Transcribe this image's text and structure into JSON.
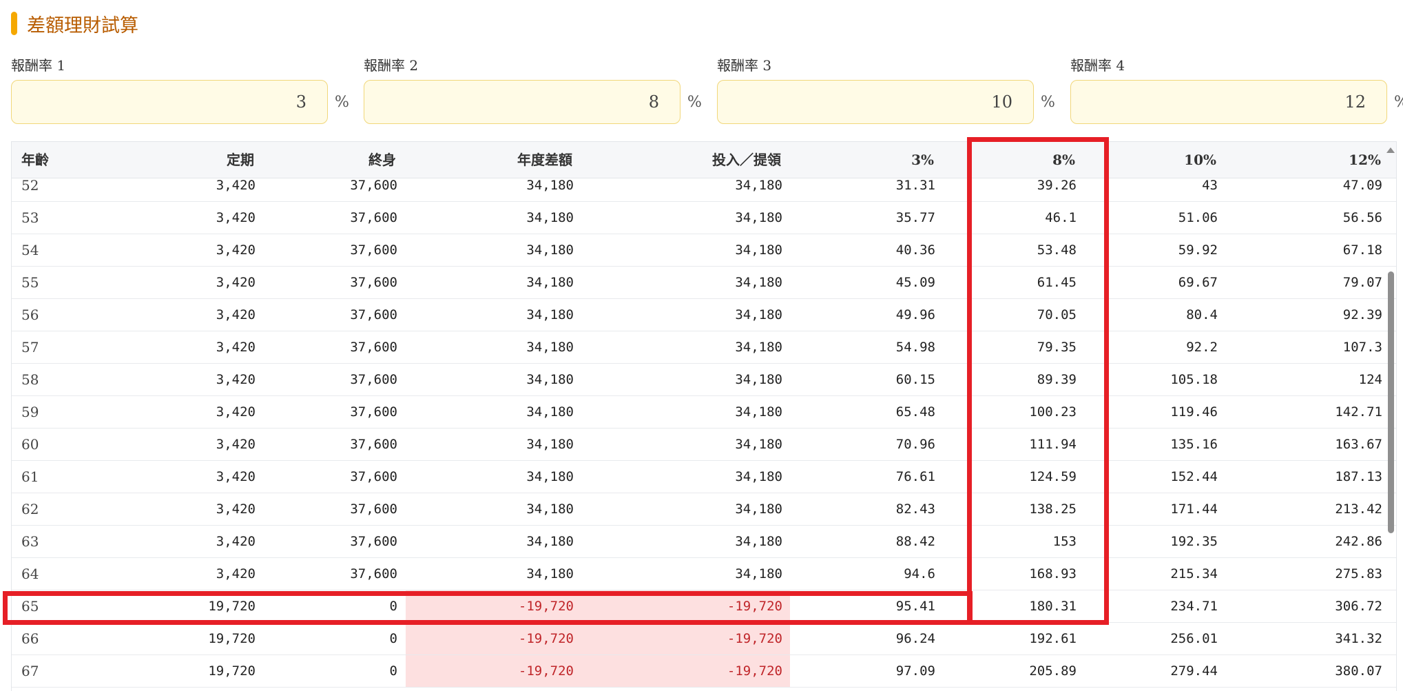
{
  "section": {
    "title": "差額理財試算"
  },
  "rates": [
    {
      "label": "報酬率 1",
      "value": "3",
      "unit": "%"
    },
    {
      "label": "報酬率 2",
      "value": "8",
      "unit": "%"
    },
    {
      "label": "報酬率 3",
      "value": "10",
      "unit": "%"
    },
    {
      "label": "報酬率 4",
      "value": "12",
      "unit": "%"
    }
  ],
  "table": {
    "columns": [
      "年齡",
      "定期",
      "終身",
      "年度差額",
      "投入／提領",
      "3%",
      "8%",
      "10%",
      "12%"
    ],
    "rows": [
      [
        "52",
        "3,420",
        "37,600",
        "34,180",
        "34,180",
        "31.31",
        "39.26",
        "43",
        "47.09"
      ],
      [
        "53",
        "3,420",
        "37,600",
        "34,180",
        "34,180",
        "35.77",
        "46.1",
        "51.06",
        "56.56"
      ],
      [
        "54",
        "3,420",
        "37,600",
        "34,180",
        "34,180",
        "40.36",
        "53.48",
        "59.92",
        "67.18"
      ],
      [
        "55",
        "3,420",
        "37,600",
        "34,180",
        "34,180",
        "45.09",
        "61.45",
        "69.67",
        "79.07"
      ],
      [
        "56",
        "3,420",
        "37,600",
        "34,180",
        "34,180",
        "49.96",
        "70.05",
        "80.4",
        "92.39"
      ],
      [
        "57",
        "3,420",
        "37,600",
        "34,180",
        "34,180",
        "54.98",
        "79.35",
        "92.2",
        "107.3"
      ],
      [
        "58",
        "3,420",
        "37,600",
        "34,180",
        "34,180",
        "60.15",
        "89.39",
        "105.18",
        "124"
      ],
      [
        "59",
        "3,420",
        "37,600",
        "34,180",
        "34,180",
        "65.48",
        "100.23",
        "119.46",
        "142.71"
      ],
      [
        "60",
        "3,420",
        "37,600",
        "34,180",
        "34,180",
        "70.96",
        "111.94",
        "135.16",
        "163.67"
      ],
      [
        "61",
        "3,420",
        "37,600",
        "34,180",
        "34,180",
        "76.61",
        "124.59",
        "152.44",
        "187.13"
      ],
      [
        "62",
        "3,420",
        "37,600",
        "34,180",
        "34,180",
        "82.43",
        "138.25",
        "171.44",
        "213.42"
      ],
      [
        "63",
        "3,420",
        "37,600",
        "34,180",
        "34,180",
        "88.42",
        "153",
        "192.35",
        "242.86"
      ],
      [
        "64",
        "3,420",
        "37,600",
        "34,180",
        "34,180",
        "94.6",
        "168.93",
        "215.34",
        "275.83"
      ],
      [
        "65",
        "19,720",
        "0",
        "-19,720",
        "-19,720",
        "95.41",
        "180.31",
        "234.71",
        "306.72"
      ],
      [
        "66",
        "19,720",
        "0",
        "-19,720",
        "-19,720",
        "96.24",
        "192.61",
        "256.01",
        "341.32"
      ],
      [
        "67",
        "19,720",
        "0",
        "-19,720",
        "-19,720",
        "97.09",
        "205.89",
        "279.44",
        "380.07"
      ]
    ]
  },
  "colors": {
    "accent": "#f5a800",
    "title": "#b85c00",
    "input_bg": "#fffbe6",
    "negative_text": "#c0262a",
    "negative_bg": "#fde0e0",
    "highlight": "#e61f26"
  }
}
